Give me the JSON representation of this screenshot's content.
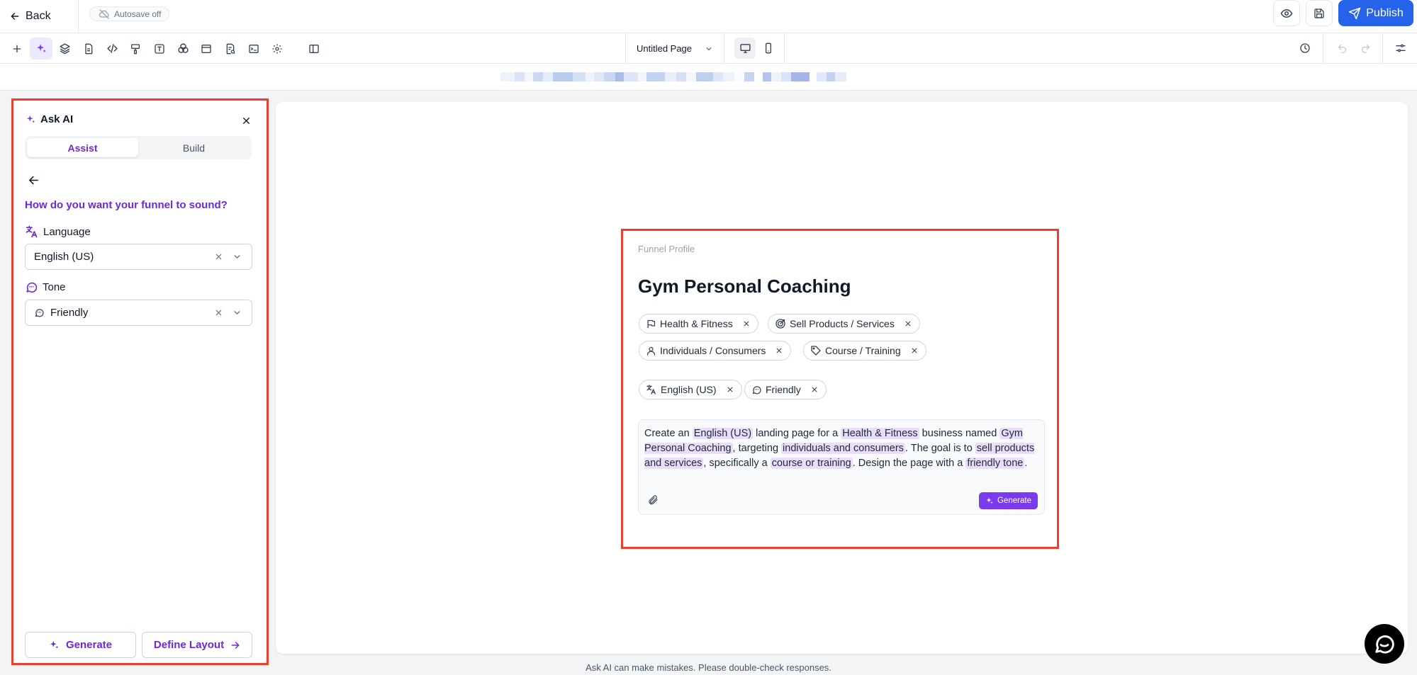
{
  "topbar": {
    "back_label": "Back",
    "autosave_label": "Autosave off",
    "publish_label": "Publish",
    "accent": "#2563eb"
  },
  "toolbar": {
    "page_name": "Untitled Page",
    "tools": [
      "add-icon",
      "ai-sparkle-icon",
      "layers-icon",
      "page-icon",
      "code-icon",
      "paint-icon",
      "text-icon",
      "colors-icon",
      "section-icon",
      "form-icon",
      "terminal-icon",
      "settings-cog-icon",
      "split-view-icon"
    ]
  },
  "ask_ai": {
    "title": "Ask AI",
    "tabs": [
      "Assist",
      "Build"
    ],
    "active_tab": "Assist",
    "question": "How do you want your funnel to sound?",
    "language": {
      "label": "Language",
      "value": "English (US)"
    },
    "tone": {
      "label": "Tone",
      "value": "Friendly"
    },
    "generate_label": "Generate",
    "define_layout_label": "Define Layout",
    "accent": "#6d28d9"
  },
  "profile": {
    "eyebrow": "Funnel Profile",
    "title": "Gym Personal Coaching",
    "chips": {
      "industry": "Health & Fitness",
      "goal": "Sell Products / Services",
      "audience": "Individuals / Consumers",
      "offer": "Course / Training",
      "language": "English (US)",
      "tone": "Friendly"
    },
    "prompt": {
      "t1": "Create an ",
      "h1": "English (US)",
      "t2": " landing page for a ",
      "h2": "Health & Fitness",
      "t3": " business named ",
      "h3": "Gym Personal Coaching",
      "t4": ", targeting ",
      "h4": "individuals and consumers",
      "t5": ". The goal is to ",
      "h5": "sell products and services",
      "t6": ", specifically a ",
      "h6": "course or training",
      "t7": ". Design the page with a ",
      "h7": "friendly tone",
      "t8": "."
    },
    "generate_label": "Generate"
  },
  "disclaimer": "Ask AI can make mistakes. Please double-check responses."
}
